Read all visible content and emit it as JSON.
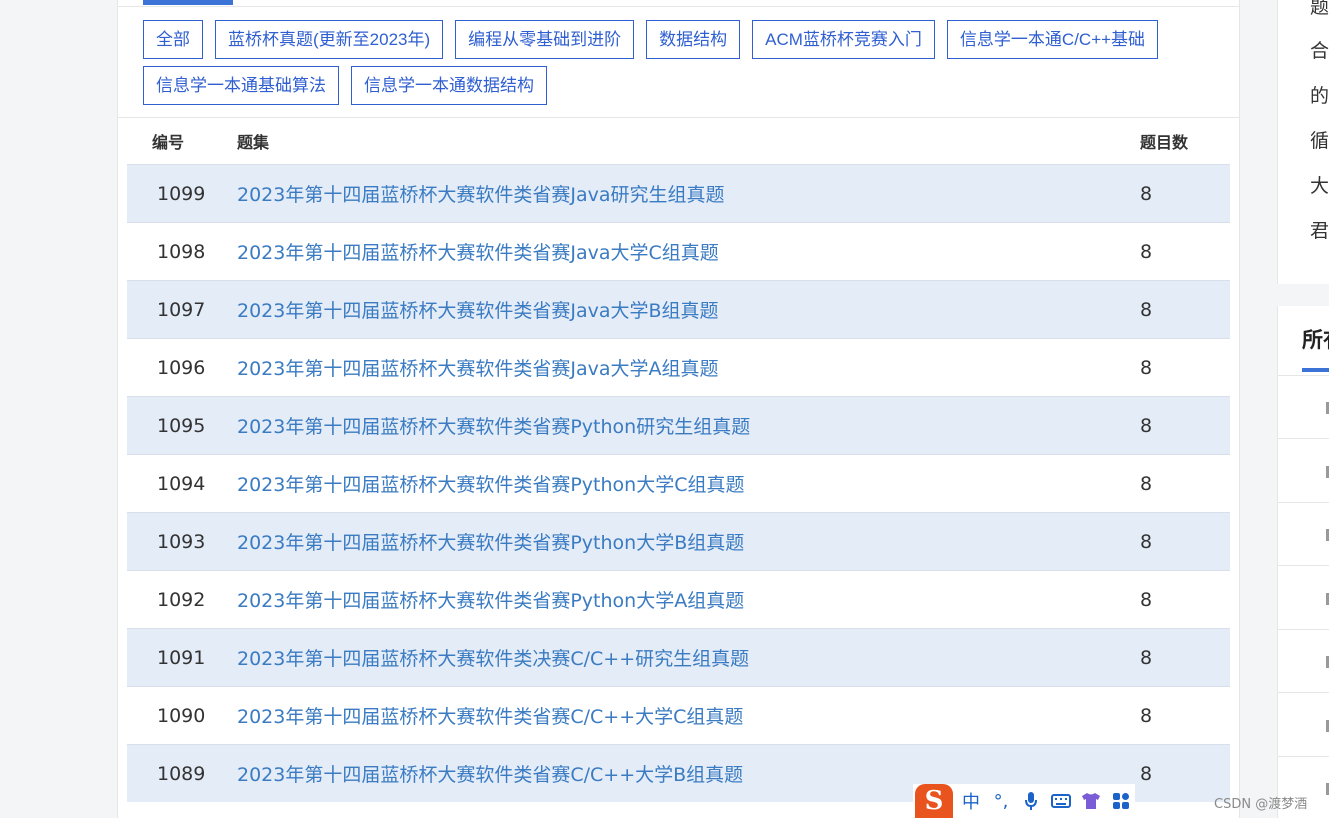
{
  "filters": [
    "全部",
    "蓝桥杯真题(更新至2023年)",
    "编程从零基础到进阶",
    "数据结构",
    "ACM蓝桥杯竞赛入门",
    "信息学一本通C/C++基础",
    "信息学一本通基础算法",
    "信息学一本通数据结构"
  ],
  "table": {
    "headers": {
      "id": "编号",
      "name": "题集",
      "count": "题目数"
    },
    "rows": [
      {
        "id": "1099",
        "name": "2023年第十四届蓝桥杯大赛软件类省赛Java研究生组真题",
        "count": "8"
      },
      {
        "id": "1098",
        "name": "2023年第十四届蓝桥杯大赛软件类省赛Java大学C组真题",
        "count": "8"
      },
      {
        "id": "1097",
        "name": "2023年第十四届蓝桥杯大赛软件类省赛Java大学B组真题",
        "count": "8"
      },
      {
        "id": "1096",
        "name": "2023年第十四届蓝桥杯大赛软件类省赛Java大学A组真题",
        "count": "8"
      },
      {
        "id": "1095",
        "name": "2023年第十四届蓝桥杯大赛软件类省赛Python研究生组真题",
        "count": "8"
      },
      {
        "id": "1094",
        "name": "2023年第十四届蓝桥杯大赛软件类省赛Python大学C组真题",
        "count": "8"
      },
      {
        "id": "1093",
        "name": "2023年第十四届蓝桥杯大赛软件类省赛Python大学B组真题",
        "count": "8"
      },
      {
        "id": "1092",
        "name": "2023年第十四届蓝桥杯大赛软件类省赛Python大学A组真题",
        "count": "8"
      },
      {
        "id": "1091",
        "name": "2023年第十四届蓝桥杯大赛软件类决赛C/C++研究生组真题",
        "count": "8"
      },
      {
        "id": "1090",
        "name": "2023年第十四届蓝桥杯大赛软件类省赛C/C++大学C组真题",
        "count": "8"
      },
      {
        "id": "1089",
        "name": "2023年第十四届蓝桥杯大赛软件类省赛C/C++大学B组真题",
        "count": "8"
      }
    ]
  },
  "right_panel": {
    "chars": [
      "题",
      "合",
      "的",
      "循",
      "大",
      "君"
    ],
    "title": "所有"
  },
  "ime": {
    "logo": "S",
    "mode": "中",
    "punct": "°,"
  },
  "watermark": "CSDN @渡梦酒",
  "colors": {
    "accent": "#3b73d6",
    "link": "#3a7bc2",
    "row_alt": "#e4ecf8",
    "ime_logo": "#e8531e"
  }
}
